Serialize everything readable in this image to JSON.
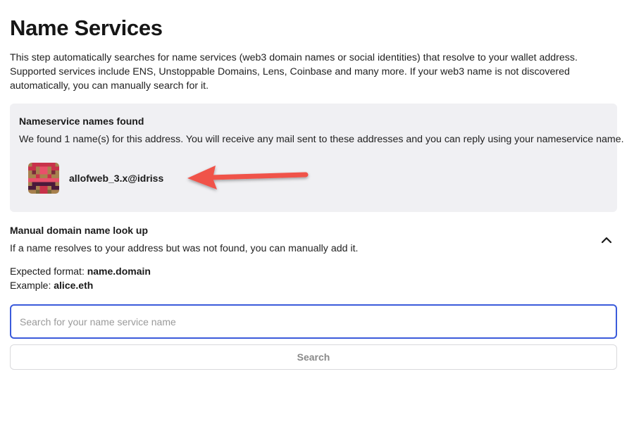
{
  "page": {
    "title": "Name Services",
    "intro": "This step automatically searches for name services (web3 domain names or social identities) that resolve to your wallet address. Supported services include ENS, Unstoppable Domains, Lens, Coinbase and many more. If your web3 name is not discovered automatically, you can manually search for it."
  },
  "found": {
    "title": "Nameservice names found",
    "description": "We found 1 name(s) for this address. You will receive any mail sent to these addresses and you can reply using your nameservice name.",
    "names": [
      {
        "label": "allofweb_3.x@idriss",
        "avatar_icon": "pixel-avatar-icon"
      }
    ]
  },
  "manual": {
    "title": "Manual domain name look up",
    "description": "If a name resolves to your address but was not found, you can manually add it.",
    "format_prefix": "Expected format: ",
    "format_value": "name.domain",
    "example_prefix": "Example: ",
    "example_value": "alice.eth",
    "collapse_icon": "chevron-up-icon"
  },
  "search": {
    "placeholder": "Search for your name service name",
    "value": "",
    "button_label": "Search"
  },
  "colors": {
    "panel_bg": "#f0f0f3",
    "input_focus_border": "#3b5bdb",
    "annotation_arrow": "#f0524a"
  }
}
